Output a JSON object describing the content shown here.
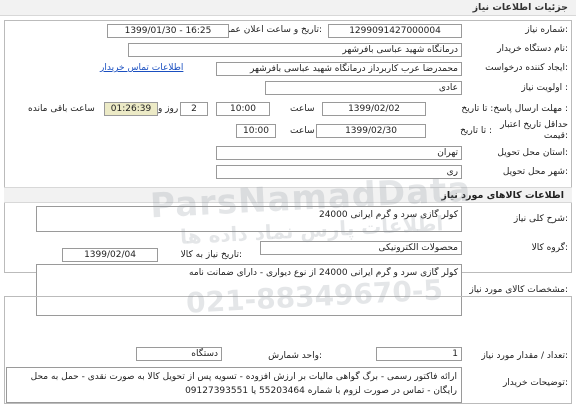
{
  "header": {
    "title": "جزئیات اطلاعات نیاز"
  },
  "fields": {
    "need_number_label": "شماره نیاز:",
    "need_number": "1299091427000004",
    "announce_label": "تاریخ و ساعت اعلان عمومی:",
    "announce_value": "1399/01/30 - 16:25",
    "buyer_label": "نام دستگاه خریدار:",
    "buyer": "درمانگاه شهید عباسی بافرشهر",
    "creator_label": "ایجاد کننده درخواست:",
    "creator": "محمدرضا عرب کاربرداز درمانگاه شهید عباسی بافرشهر",
    "contact_link": "اطلاعات تماس خریدار",
    "priority_label": "اولویت نیاز :",
    "priority": "عادی",
    "deadline_label": "مهلت ارسال پاسخ: تا تاریخ :",
    "deadline_date": "1399/02/02",
    "time_label_1": "ساعت",
    "deadline_time": "10:00",
    "days_value": "2",
    "days_label": "روز و",
    "remaining_time": "01:26:39",
    "remaining_label": "ساعت باقی مانده",
    "validity_label_1": "حداقل تاریخ اعتبار",
    "validity_label_2": "قیمت:",
    "validity_prefix": "تا تاریخ :",
    "validity_date": "1399/02/30",
    "time_label_2": "ساعت",
    "validity_time": "10:00",
    "province_label": "استان محل تحویل:",
    "province": "تهران",
    "city_label": "شهر محل تحویل:",
    "city": "ری"
  },
  "goods_section": {
    "title": "اطلاعات کالاهای مورد نیاز"
  },
  "goods": {
    "summary_label": "شرح کلی نیاز:",
    "summary": "کولر گازی سرد و گرم ایرانی 24000",
    "group_label": "گروه کالا:",
    "group": "محصولات الکترونیکی",
    "need_date_label": "تاریخ نیاز به کالا:",
    "need_date": "1399/02/04",
    "spec_label": "مشخصات کالای مورد نیاز:",
    "spec": "کولر گازی سرد و گرم ایرانی 24000 از نوع دیواری - دارای ضمانت نامه",
    "qty_label": "تعداد / مقدار مورد نیاز:",
    "qty": "1",
    "unit_label": "واحد شمارش:",
    "unit": "دستگاه",
    "notes_label": "توضیحات خریدار:",
    "notes": "ارائه فاکتور رسمی - برگ گواهی مالیات بر ارزش افزوده - تسویه پس از تحویل کالا به صورت نقدی - حمل به محل رایگان - تماس در صورت لزوم با شماره 55203464 یا 09127393551"
  },
  "watermark": {
    "brand": "ParsNamadData",
    "subtitle": "اطلاعات پارس نماد داده ها",
    "phone": "021-88349670-5"
  }
}
